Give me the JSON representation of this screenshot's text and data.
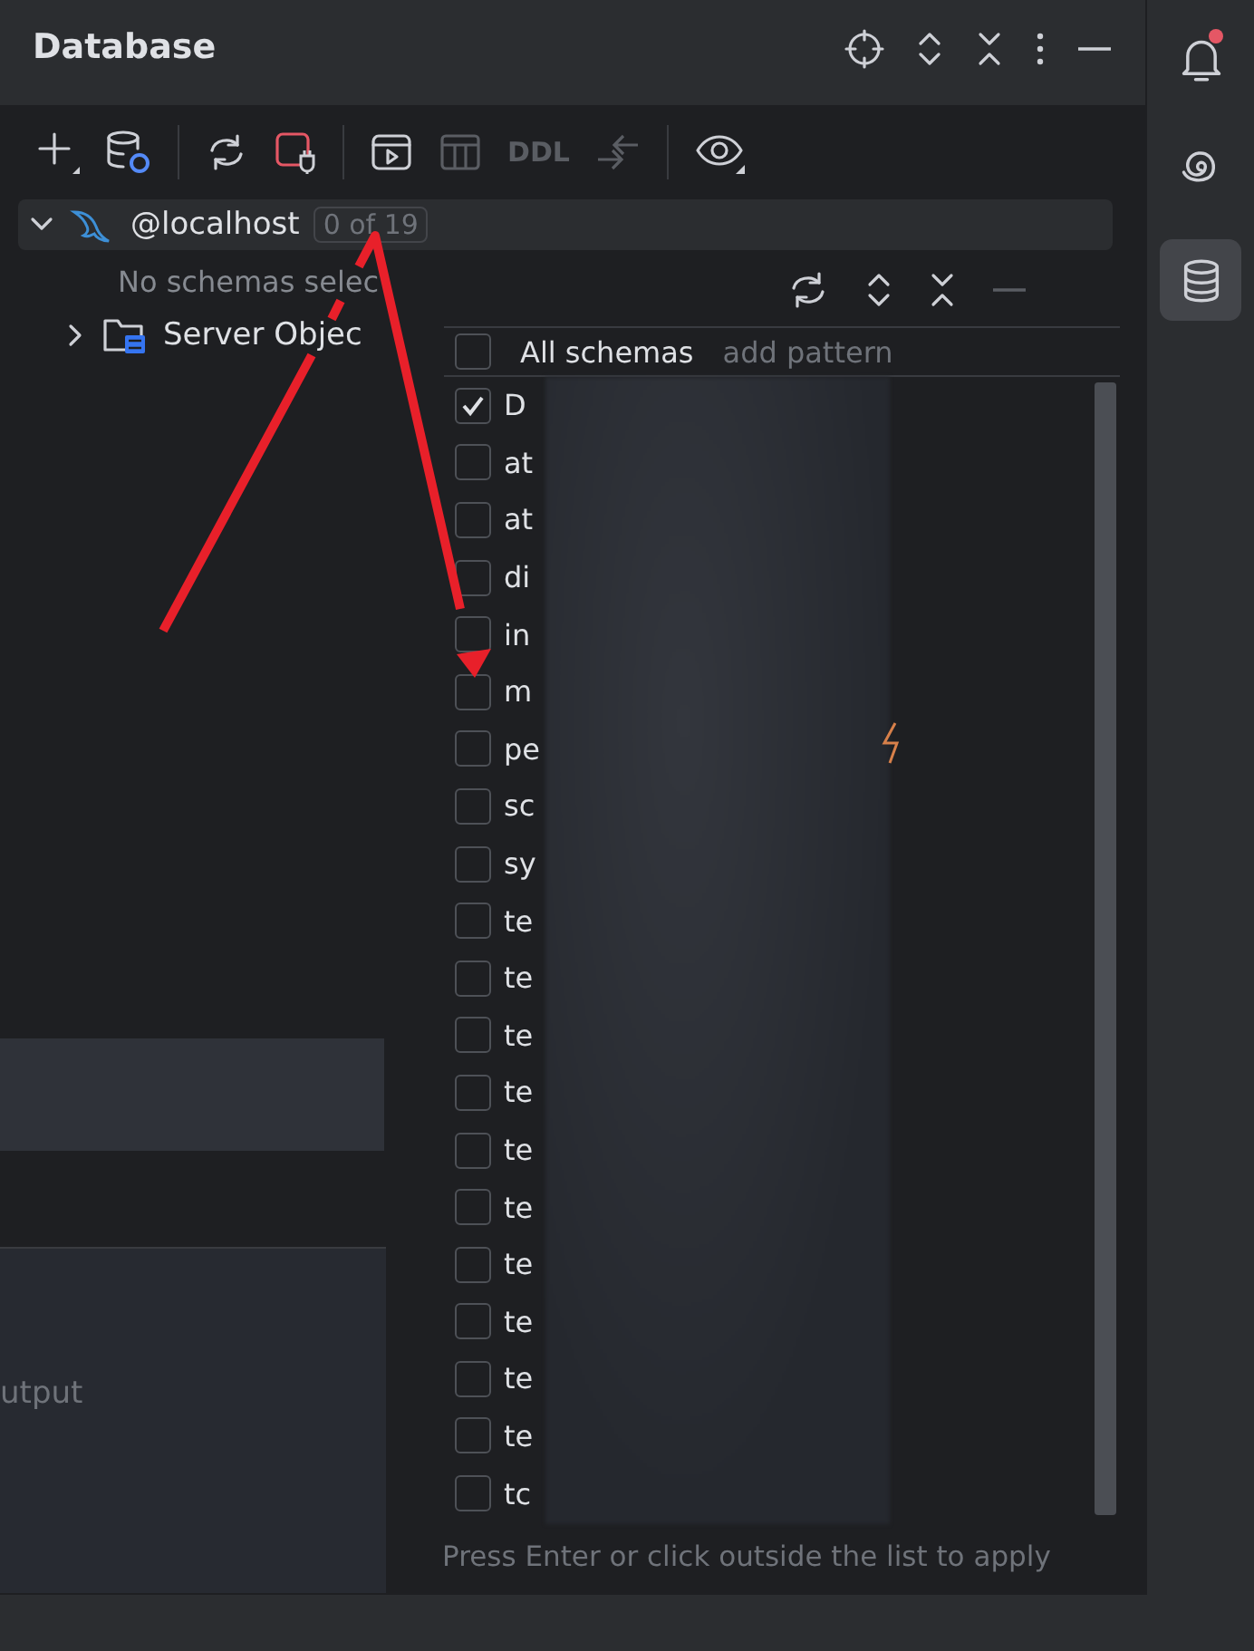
{
  "panel": {
    "title": "Database"
  },
  "toolbar": {
    "ddl_label": "DDL"
  },
  "tree": {
    "label": "@localhost",
    "badge": "0 of 19",
    "expanded": true,
    "note": "No schemas selec",
    "children": [
      {
        "label": "Server Objec",
        "expanded": false
      }
    ]
  },
  "schema_popup": {
    "all_label": "All schemas",
    "all_checked": false,
    "pattern_link": "add pattern",
    "items": [
      {
        "label": "D",
        "checked": true
      },
      {
        "label": "at",
        "checked": false
      },
      {
        "label": "at",
        "checked": false
      },
      {
        "label": "di",
        "checked": false
      },
      {
        "label": "in",
        "checked": false
      },
      {
        "label": "m",
        "checked": false
      },
      {
        "label": "pe",
        "checked": false
      },
      {
        "label": "sc",
        "checked": false
      },
      {
        "label": "sy",
        "checked": false
      },
      {
        "label": "te",
        "checked": false
      },
      {
        "label": "te",
        "checked": false
      },
      {
        "label": "te",
        "checked": false
      },
      {
        "label": "te",
        "checked": false
      },
      {
        "label": "te",
        "checked": false
      },
      {
        "label": "te",
        "checked": false
      },
      {
        "label": "te",
        "checked": false
      },
      {
        "label": "te",
        "checked": false
      },
      {
        "label": "te",
        "checked": false
      },
      {
        "label": "te",
        "checked": false
      },
      {
        "label": "tc",
        "checked": false
      }
    ],
    "hint": "Press Enter or click outside the list to apply"
  },
  "output_panel": {
    "text": "utput"
  },
  "tool_strip": [
    {
      "kind": "notifications",
      "selected": false,
      "badge": true
    },
    {
      "kind": "ai",
      "selected": false,
      "badge": false
    },
    {
      "kind": "database",
      "selected": true,
      "badge": false
    }
  ]
}
